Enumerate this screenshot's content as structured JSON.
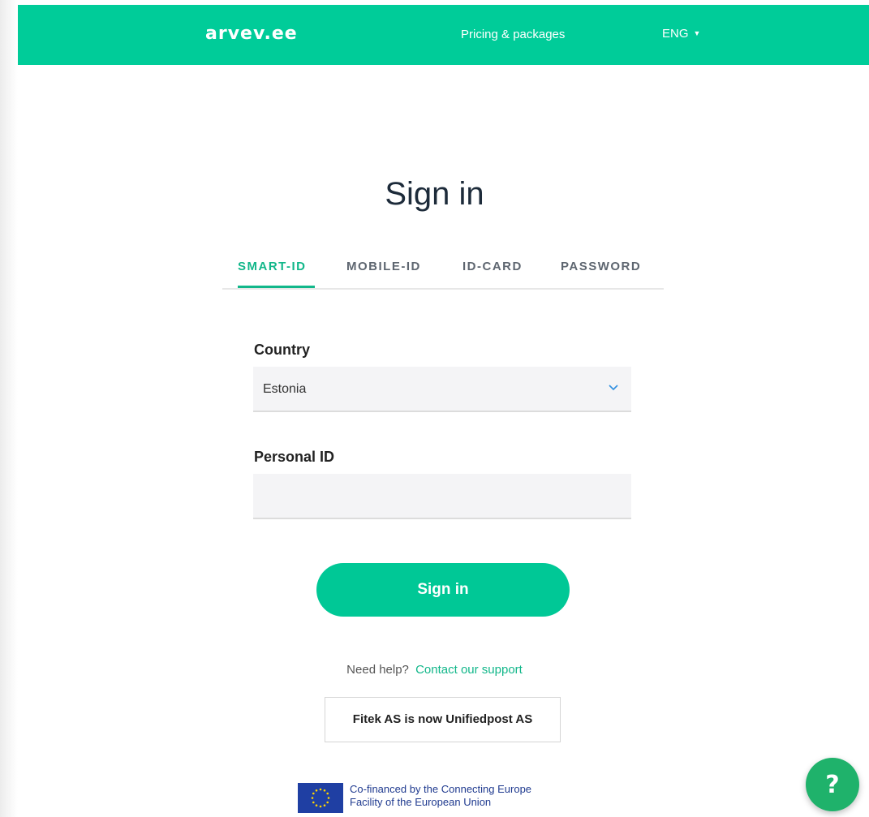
{
  "header": {
    "logo_text": "arvev.ee",
    "pricing_link": "Pricing & packages",
    "language": "ENG"
  },
  "main": {
    "title": "Sign in",
    "tabs": [
      {
        "label": "SMART-ID",
        "active": true
      },
      {
        "label": "MOBILE-ID",
        "active": false
      },
      {
        "label": "ID-CARD",
        "active": false
      },
      {
        "label": "PASSWORD",
        "active": false
      }
    ],
    "country_label": "Country",
    "country_value": "Estonia",
    "personal_id_label": "Personal ID",
    "personal_id_value": "",
    "submit_label": "Sign in",
    "help_text": "Need help?",
    "help_link": "Contact our support",
    "notice": "Fitek AS is now Unifiedpost AS"
  },
  "footer": {
    "eu_line1": "Co-financed by the Connecting Europe",
    "eu_line2": "Facility of the European Union",
    "eu_icon": "eu-flag-icon"
  },
  "help_fab": {
    "label": "?",
    "icon": "help-icon"
  },
  "colors": {
    "brand": "#00cc99",
    "accent": "#12b78a",
    "button": "#00c896",
    "fab": "#1fb26b"
  }
}
